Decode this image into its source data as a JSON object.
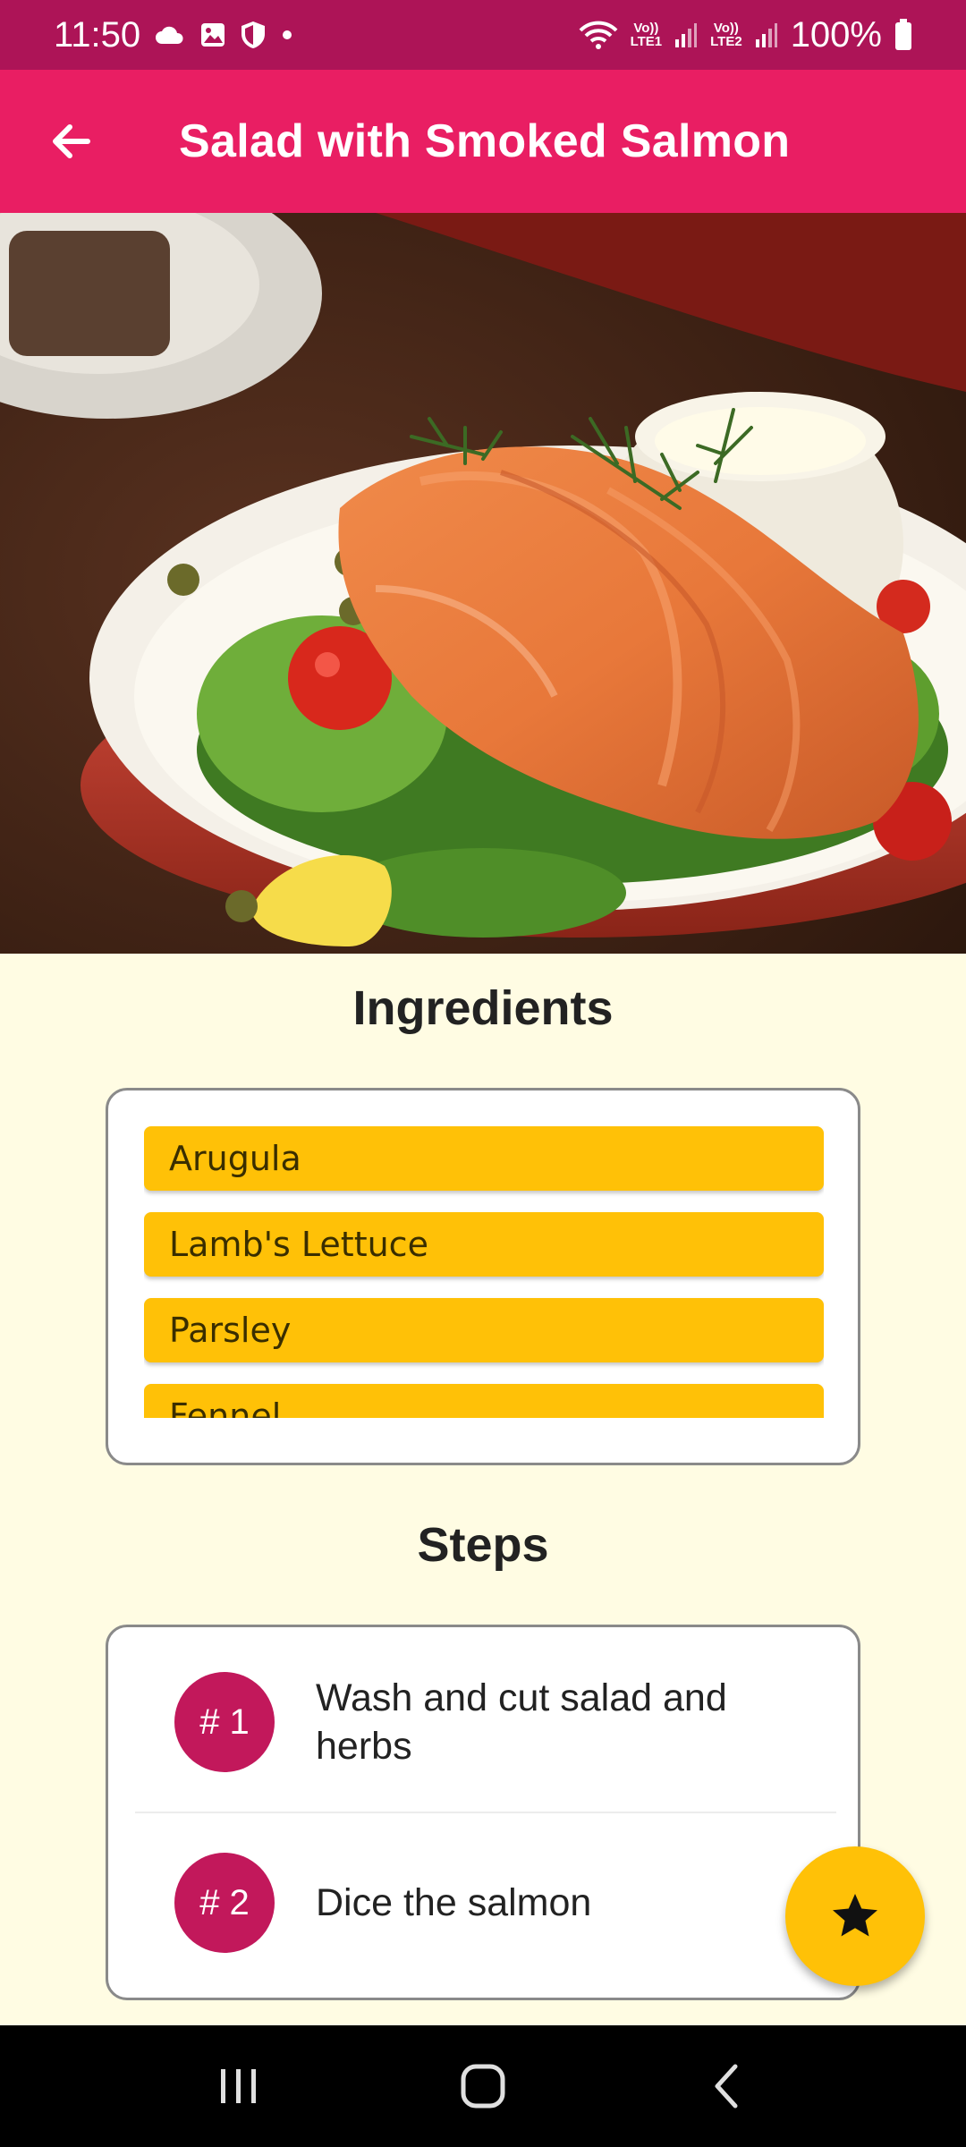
{
  "status_bar": {
    "time": "11:50",
    "battery": "100%",
    "lte1": "LTE1",
    "lte2": "LTE2",
    "volte1": "Vo))",
    "volte2": "Vo))",
    "icons": [
      "cloud-icon",
      "image-icon",
      "shield-icon",
      "dot-icon",
      "wifi-icon",
      "signal-icon",
      "battery-icon"
    ]
  },
  "app_bar": {
    "title": "Salad with Smoked Salmon",
    "back_icon": "arrow-back-icon"
  },
  "ingredients": {
    "title": "Ingredients",
    "items": [
      {
        "label": "Arugula"
      },
      {
        "label": "Lamb's Lettuce"
      },
      {
        "label": "Parsley"
      },
      {
        "label": "Fennel"
      }
    ]
  },
  "steps": {
    "title": "Steps",
    "items": [
      {
        "number": "# 1",
        "text": "Wash and cut salad and herbs"
      },
      {
        "number": "# 2",
        "text": "Dice the salmon"
      }
    ]
  },
  "fab": {
    "icon": "star-icon"
  },
  "nav_bar": {
    "icons": [
      "recent-apps-icon",
      "home-icon",
      "back-icon"
    ]
  },
  "colors": {
    "status_bar": "#ad1457",
    "app_bar": "#e91e63",
    "background": "#fffce3",
    "ingredient_chip": "#ffc107",
    "step_badge": "#c2185b",
    "fab": "#ffc107"
  }
}
